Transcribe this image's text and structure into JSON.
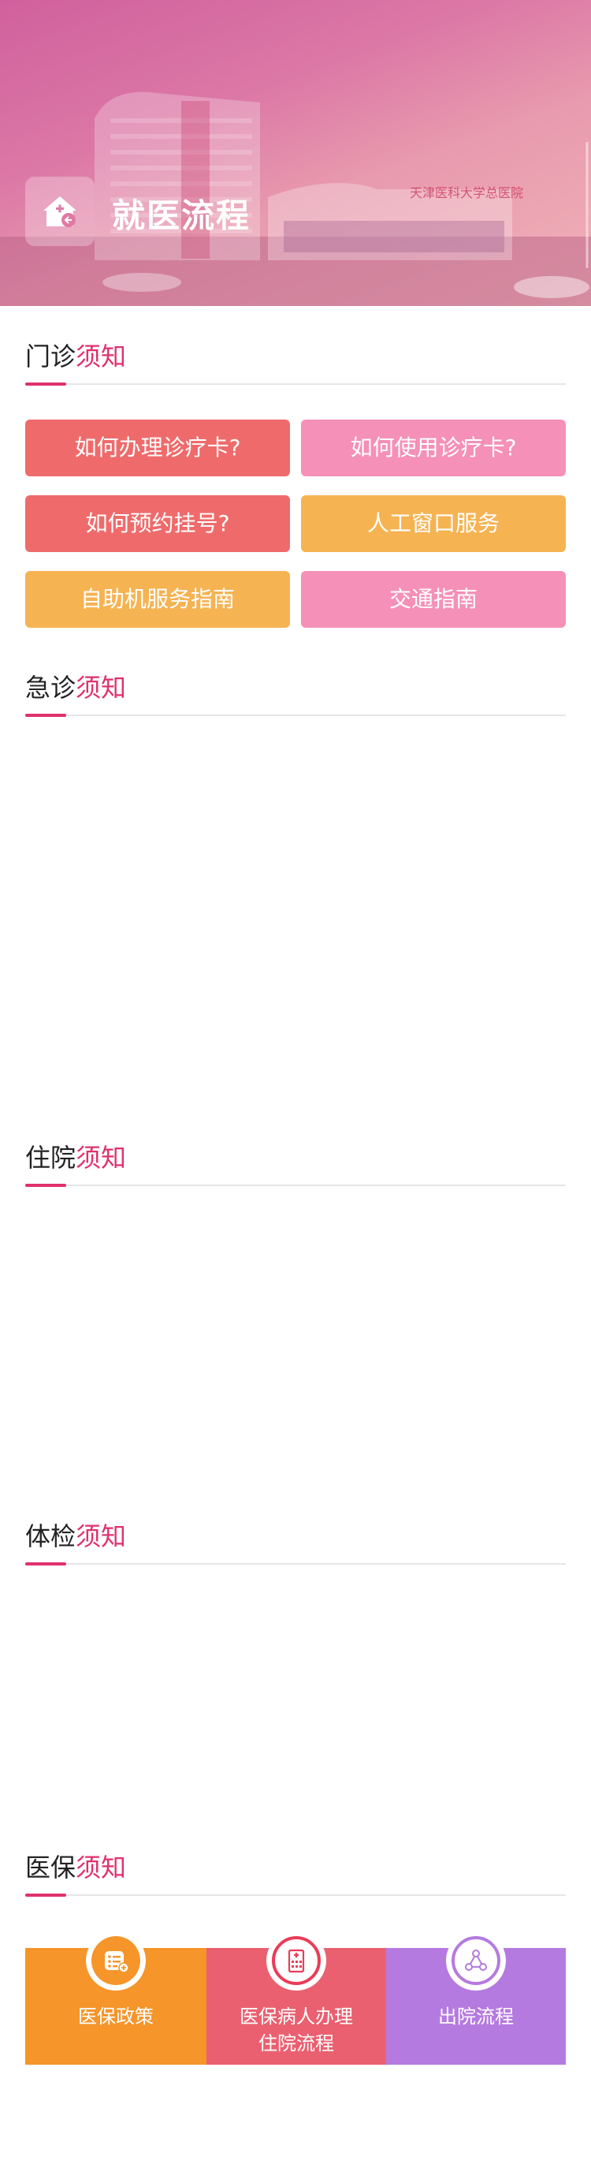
{
  "header": {
    "title": "就医流程",
    "logo_icon": "hospital-house-icon",
    "sign_text": "天津医科大学总医院"
  },
  "sections": {
    "outpatient": {
      "label_a": "门诊",
      "label_b": "须知"
    },
    "emergency": {
      "label_a": "急诊",
      "label_b": "须知"
    },
    "inpatient": {
      "label_a": "住院",
      "label_b": "须知"
    },
    "checkup": {
      "label_a": "体检",
      "label_b": "须知"
    },
    "insurance": {
      "label_a": "医保",
      "label_b": "须知"
    }
  },
  "outpatient_buttons": [
    {
      "label": "如何办理诊疗卡?",
      "color": "#ef6b6b"
    },
    {
      "label": "如何使用诊疗卡?",
      "color": "#f590b8"
    },
    {
      "label": "如何预约挂号?",
      "color": "#ef6b6b"
    },
    {
      "label": "人工窗口服务",
      "color": "#f6b352"
    },
    {
      "label": "自助机服务指南",
      "color": "#f6b352"
    },
    {
      "label": "交通指南",
      "color": "#f590b8"
    }
  ],
  "insurance_steps": [
    {
      "line1": "医保政策",
      "line2": "",
      "icon": "policy-list-icon",
      "color": "#f5952a"
    },
    {
      "line1": "医保病人办理",
      "line2": "住院流程",
      "icon": "hospital-building-icon",
      "color": "#ea6070"
    },
    {
      "line1": "出院流程",
      "line2": "",
      "icon": "flow-nodes-icon",
      "color": "#b57ae0"
    }
  ]
}
